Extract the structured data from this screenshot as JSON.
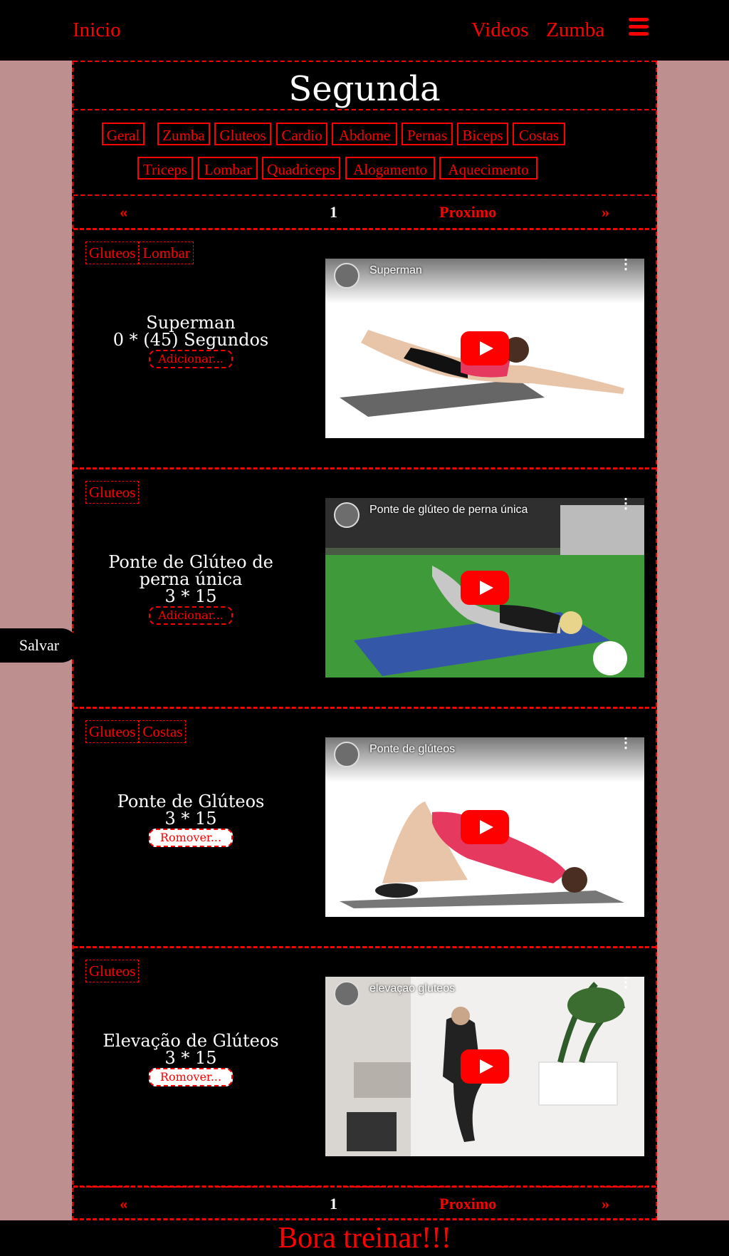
{
  "nav": {
    "home": "Inicio",
    "videos": "Videos",
    "zumba": "Zumba",
    "menu_icon": "hamburger-icon"
  },
  "day_title": "Segunda",
  "filters": [
    "Geral",
    "Zumba",
    "Gluteos",
    "Cardio",
    "Abdome",
    "Pernas",
    "Biceps",
    "Costas",
    "Triceps",
    "Lombar",
    "Quadriceps",
    "Alogamento",
    "Aquecimento"
  ],
  "pager": {
    "first": "«",
    "page": "1",
    "next": "Proximo",
    "last": "»"
  },
  "exercises": [
    {
      "tags": [
        "Gluteos",
        "Lombar"
      ],
      "name": "Superman",
      "reps": "0 * (45) Segundos",
      "button": "Adicionar...",
      "video_title": "Superman"
    },
    {
      "tags": [
        "Gluteos"
      ],
      "name": "Ponte de Glúteo de perna única",
      "reps": "3 * 15",
      "button": "Adicionar...",
      "video_title": "Ponte de glúteo de perna única"
    },
    {
      "tags": [
        "Gluteos",
        "Costas"
      ],
      "name": "Ponte de Glúteos",
      "reps": "3 * 15",
      "button": "Romover...",
      "video_title": "Ponte de glúteos"
    },
    {
      "tags": [
        "Gluteos"
      ],
      "name": "Elevação de Glúteos",
      "reps": "3 * 15",
      "button": "Romover...",
      "video_title": "elevaçao gluteos"
    }
  ],
  "save_button": "Salvar",
  "footer_text": "Bora treinar!!!",
  "colors": {
    "accent": "#ff0000",
    "background": "#bd8f8f",
    "panel": "#000000"
  }
}
